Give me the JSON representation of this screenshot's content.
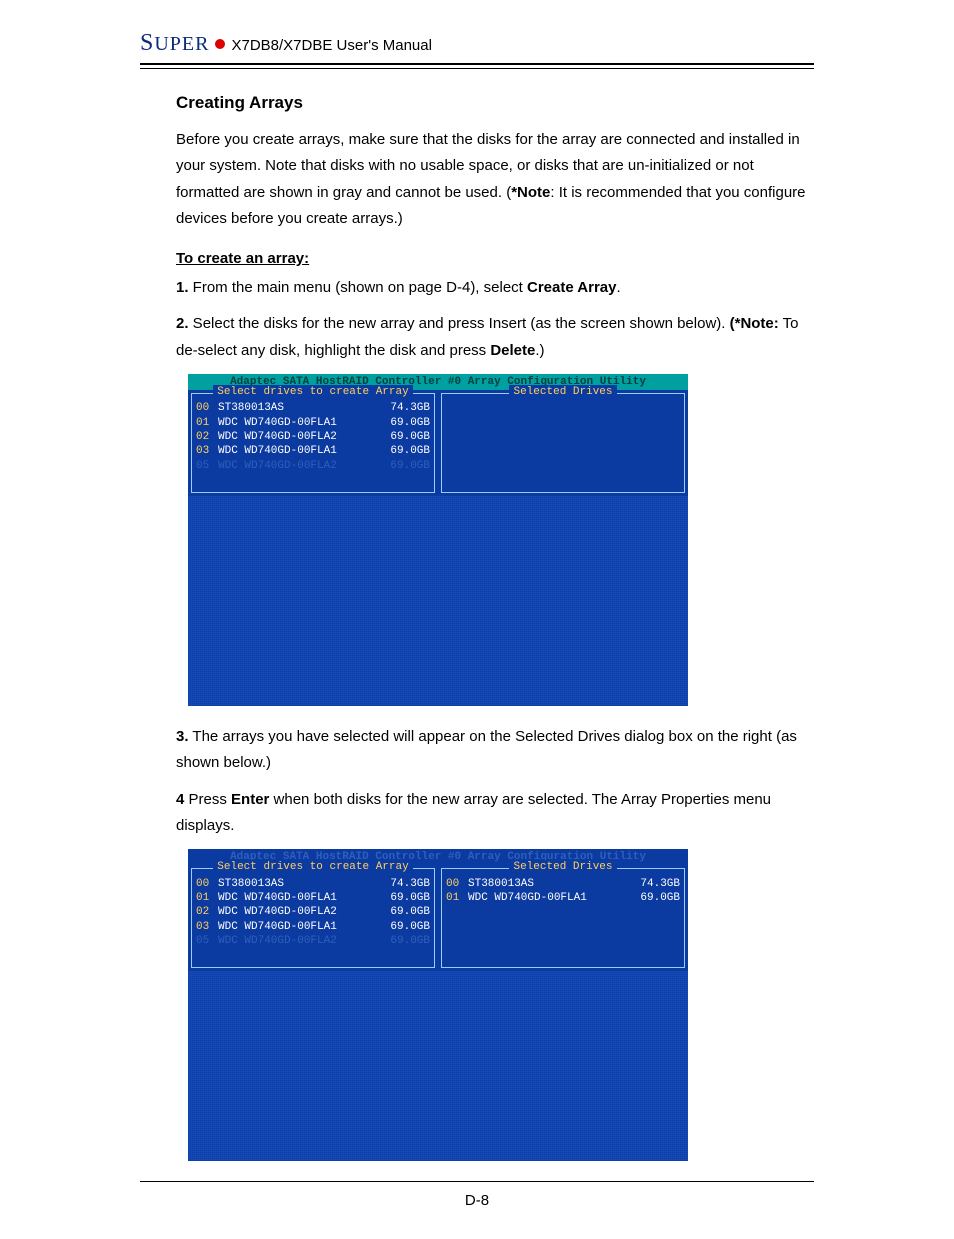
{
  "header": {
    "brand_first": "S",
    "brand_rest": "UPER",
    "manual_title": "X7DB8/X7DBE User's Manual"
  },
  "section": {
    "heading": "Creating Arrays",
    "intro_1": "Before you create arrays, make sure that the disks for the array are connected and installed in your system. Note that disks with no usable space, or disks that are un-initialized or not formatted are shown in gray and cannot be used. (",
    "intro_note_bold": "*Note",
    "intro_2": ": It is recommended that you configure devices before you create arrays.)",
    "steps_title": "To create an array:",
    "step1_a": "1.",
    "step1_b": " From the main menu (shown on page D-4), select ",
    "step1_bold": "Create Array",
    "step1_c": ".",
    "step2_a": "2.",
    "step2_b": " Select the disks for the new array and press Insert (as the screen shown below). ",
    "step2_note_bold": "(*Note:",
    "step2_c": " To de-select any disk, highlight the disk and press ",
    "step2_delete": "Delete",
    "step2_d": ".)",
    "step3_a": "3.",
    "step3_b": " The arrays you have selected will appear on the Selected Drives dialog box on the right (as shown below.)",
    "step4_a": "4",
    "step4_b": " Press ",
    "step4_enter": "Enter",
    "step4_c": " when both disks for the new array are selected. The Array Properties menu displays."
  },
  "bios1": {
    "title": "Adaptec SATA HostRAID Controller #0 Array Configuration Utility",
    "left_title": "Select drives to create Array",
    "right_title": "Selected Drives",
    "left_rows": [
      {
        "id": "00",
        "name": "ST380013AS",
        "size": "74.3GB",
        "sel": true
      },
      {
        "id": "01",
        "name": "WDC WD740GD-00FLA1",
        "size": "69.0GB",
        "sel": true
      },
      {
        "id": "02",
        "name": "WDC WD740GD-00FLA2",
        "size": "69.0GB",
        "sel": true
      },
      {
        "id": "03",
        "name": "WDC WD740GD-00FLA1",
        "size": "69.0GB",
        "sel": true
      },
      {
        "id": "05",
        "name": "WDC WD740GD-00FLA2",
        "size": "69.0GB",
        "dim": true
      }
    ],
    "right_rows": []
  },
  "bios2": {
    "title": "Adaptec SATA HostRAID Controller #0 Array Configuration Utility",
    "left_title": "Select drives to create Array",
    "right_title": "Selected Drives",
    "left_rows": [
      {
        "id": "00",
        "name": "ST380013AS",
        "size": "74.3GB",
        "sel": true
      },
      {
        "id": "01",
        "name": "WDC WD740GD-00FLA1",
        "size": "69.0GB",
        "sel": true
      },
      {
        "id": "02",
        "name": "WDC WD740GD-00FLA2",
        "size": "69.0GB",
        "sel": true
      },
      {
        "id": "03",
        "name": "WDC WD740GD-00FLA1",
        "size": "69.0GB",
        "sel": true
      },
      {
        "id": "05",
        "name": "WDC WD740GD-00FLA2",
        "size": "69.0GB",
        "dim": true
      }
    ],
    "right_rows": [
      {
        "id": "00",
        "name": "ST380013AS",
        "size": "74.3GB",
        "sel": true
      },
      {
        "id": "01",
        "name": "WDC WD740GD-00FLA1",
        "size": "69.0GB",
        "sel": true
      }
    ]
  },
  "footer": {
    "page": "D-8"
  }
}
